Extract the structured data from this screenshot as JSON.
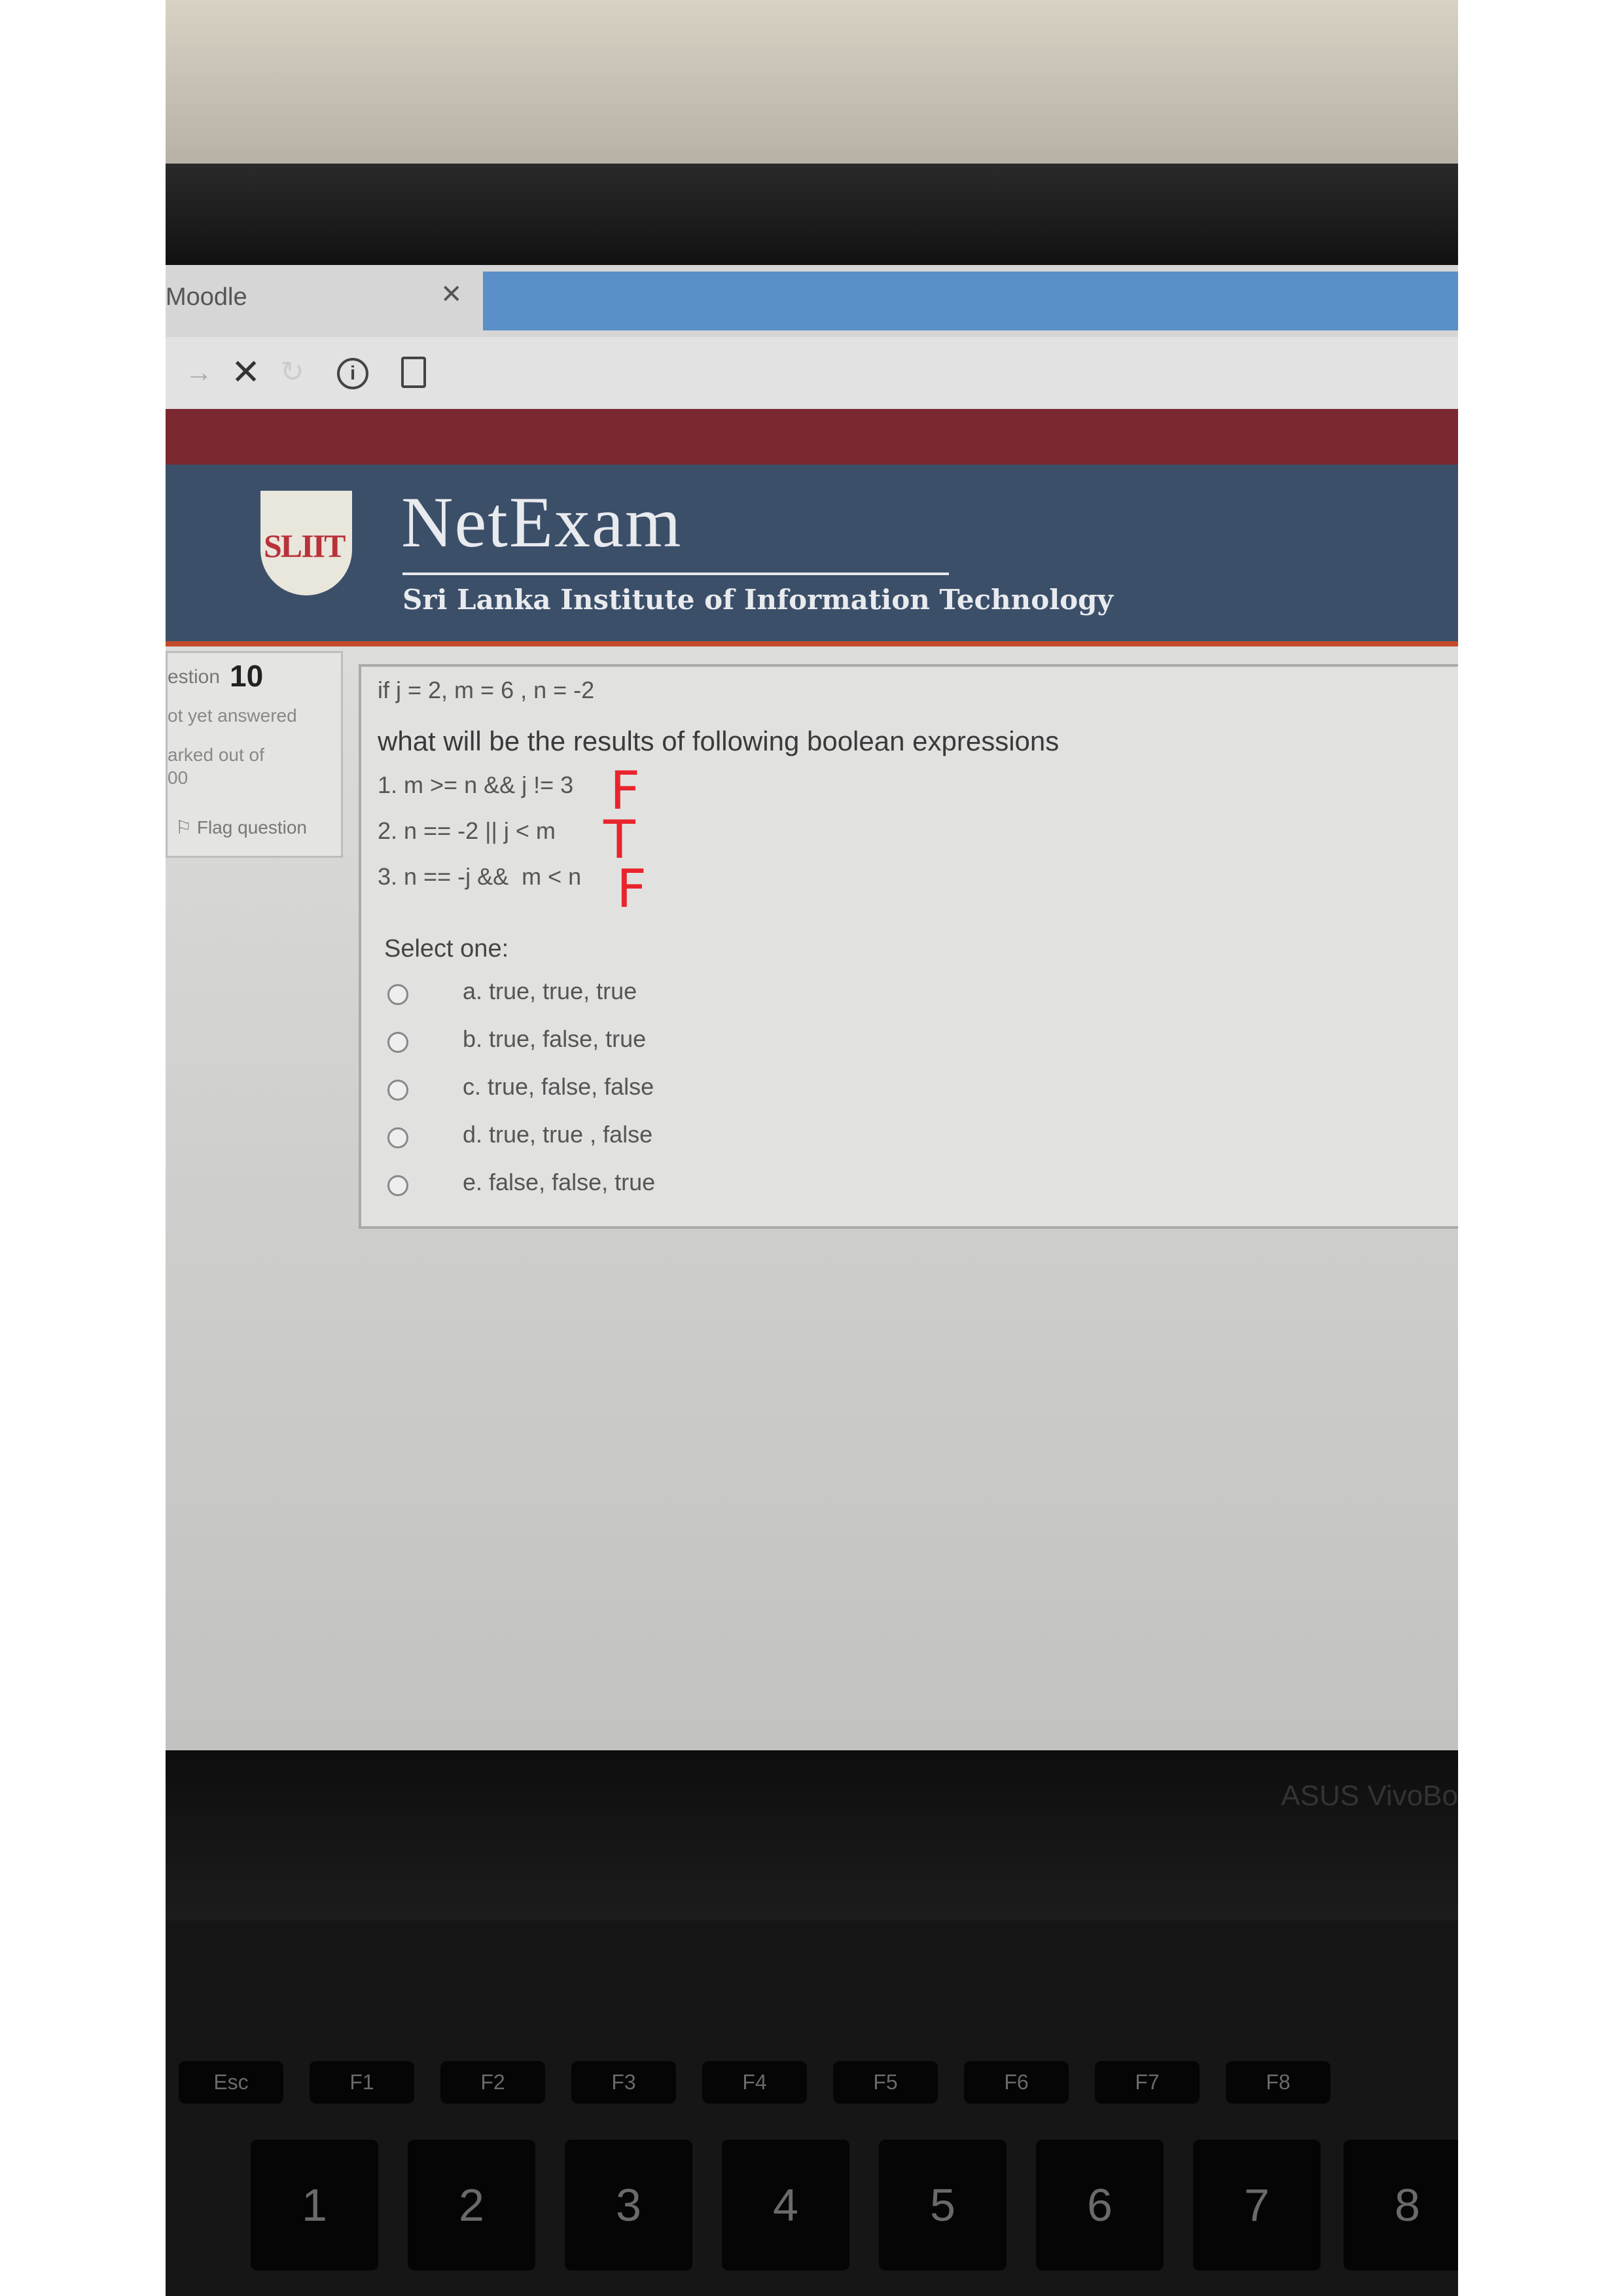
{
  "browser": {
    "tab_title": "Moodle",
    "tab_close_icon": "close-icon",
    "nav_icons": [
      "back-arrow-icon",
      "stop-icon",
      "reload-icon",
      "info-icon",
      "page-icon"
    ]
  },
  "site": {
    "logo_text": "SLIIT",
    "brand": "NetExam",
    "subtitle": "Sri Lanka Institute of Information Technology"
  },
  "info_panel": {
    "question_label": "estion",
    "question_number": "10",
    "status": "ot yet answered",
    "marked_line1": "arked out of",
    "marked_line2": "00",
    "flag_label": "Flag question"
  },
  "question": {
    "given": "if j = 2, m = 6 , n = -2",
    "intro": "what will be the results of following boolean expressions",
    "expressions": [
      "1. m >= n && j != 3",
      "2. n == -2 || j < m",
      "3. n == -j &&  m < n"
    ],
    "handwritten_marks": [
      "F",
      "T",
      "F"
    ],
    "select_label": "Select one:",
    "options": [
      "a. true, true, true",
      "b. true, false, true",
      "c. true, false, false",
      "d. true, true , false",
      "e. false, false, true"
    ]
  },
  "laptop": {
    "brand_text": "ASUS VivoBo",
    "function_keys": [
      "Esc",
      "F1",
      "F2",
      "F3",
      "F4",
      "F5",
      "F6",
      "F7",
      "F8"
    ],
    "number_keys": [
      "1",
      "2",
      "3",
      "4",
      "5",
      "6",
      "7",
      "8"
    ]
  },
  "colors": {
    "site_header": "#3b4f69",
    "top_redbar": "#7c2830",
    "header_accent": "#c44a2a",
    "tab_active": "#5a8fc8",
    "handwriting": "#e8252c"
  }
}
